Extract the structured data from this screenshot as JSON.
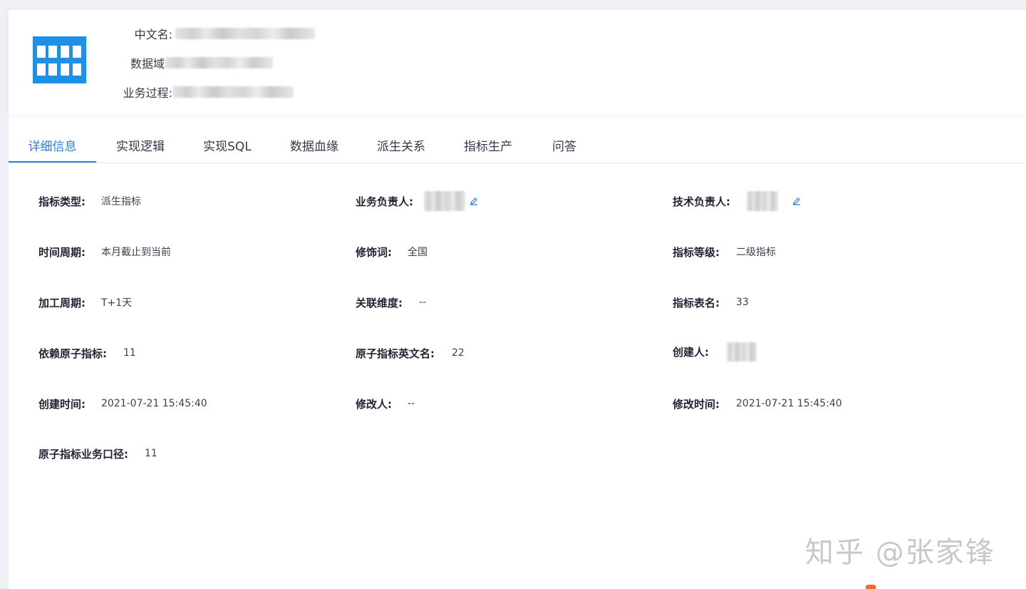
{
  "header": {
    "chinese_name_label": "中文名:",
    "domain_label": "数据域",
    "process_label": "业务过程:"
  },
  "tabs": [
    {
      "label": "详细信息",
      "active": true
    },
    {
      "label": "实现逻辑",
      "active": false
    },
    {
      "label": "实现SQL",
      "active": false
    },
    {
      "label": "数据血缘",
      "active": false
    },
    {
      "label": "派生关系",
      "active": false
    },
    {
      "label": "指标生产",
      "active": false
    },
    {
      "label": "问答",
      "active": false
    }
  ],
  "details": {
    "metric_type": {
      "label": "指标类型:",
      "value": "派生指标"
    },
    "business_owner": {
      "label": "业务负责人:"
    },
    "tech_owner": {
      "label": "技术负责人:"
    },
    "time_period": {
      "label": "时间周期:",
      "value": "本月截止到当前"
    },
    "modifier": {
      "label": "修饰词:",
      "value": "全国"
    },
    "metric_level": {
      "label": "指标等级:",
      "value": "二级指标"
    },
    "process_cycle": {
      "label": "加工周期:",
      "value": "T+1天"
    },
    "related_dimension": {
      "label": "关联维度:",
      "value": "--"
    },
    "metric_table": {
      "label": "指标表名:",
      "value": "33"
    },
    "atomic_metric": {
      "label": "依赖原子指标:",
      "value": "11"
    },
    "atomic_en_name": {
      "label": "原子指标英文名:",
      "value": "22"
    },
    "creator": {
      "label": "创建人:"
    },
    "created_time": {
      "label": "创建时间:",
      "value": "2021-07-21 15:45:40"
    },
    "modified_by": {
      "label": "修改人:",
      "value": "--"
    },
    "modified_time": {
      "label": "修改时间:",
      "value": "2021-07-21 15:45:40"
    },
    "atomic_business_scope": {
      "label": "原子指标业务口径:",
      "value": "11"
    }
  },
  "watermark": "知乎 @张家锋",
  "colors": {
    "accent": "#2a7de1",
    "logo": "#1e90e6"
  }
}
